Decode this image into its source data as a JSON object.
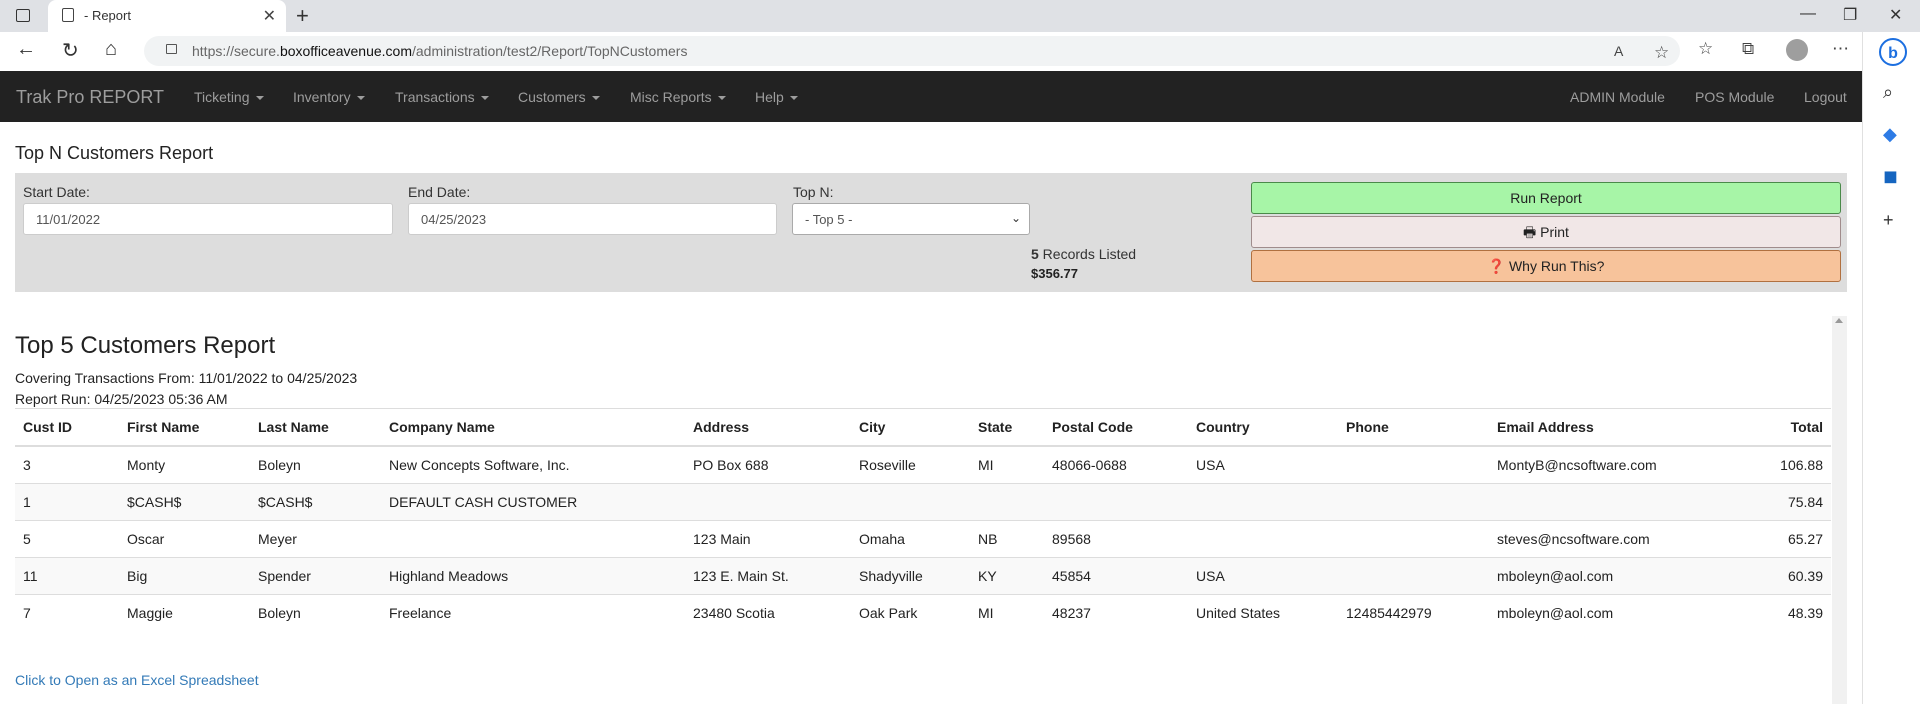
{
  "browser": {
    "tab_title": "- Report",
    "url_prefix": "https://secure.",
    "url_domain": "boxofficeavenue.com",
    "url_path": "/administration/test2/Report/TopNCustomers"
  },
  "navbar": {
    "brand": "Trak Pro REPORT",
    "menus": [
      "Ticketing",
      "Inventory",
      "Transactions",
      "Customers",
      "Misc Reports",
      "Help"
    ],
    "right_links": [
      "ADMIN Module",
      "POS Module",
      "Logout"
    ]
  },
  "page_title": "Top N Customers Report",
  "filters": {
    "start_label": "Start Date:",
    "start_value": "11/01/2022",
    "end_label": "End Date:",
    "end_value": "04/25/2023",
    "topn_label": "Top N:",
    "topn_value": "- Top 5 -",
    "records_count": "5",
    "records_suffix": " Records Listed",
    "total_amount": "$356.77"
  },
  "buttons": {
    "run": "Run Report",
    "print": "Print",
    "why": "Why Run This?"
  },
  "report": {
    "heading": "Top 5 Customers Report",
    "covering": "Covering Transactions From: 11/01/2022 to 04/25/2023",
    "run_at": "Report Run: 04/25/2023 05:36 AM",
    "columns": [
      "Cust ID",
      "First Name",
      "Last Name",
      "Company Name",
      "Address",
      "City",
      "State",
      "Postal Code",
      "Country",
      "Phone",
      "Email Address",
      "Total"
    ],
    "rows": [
      [
        "3",
        "Monty",
        "Boleyn",
        "New Concepts Software, Inc.",
        "PO Box 688",
        "Roseville",
        "MI",
        "48066-0688",
        "USA",
        "",
        "MontyB@ncsoftware.com",
        "106.88"
      ],
      [
        "1",
        "$CASH$",
        "$CASH$",
        "DEFAULT CASH CUSTOMER",
        "",
        "",
        "",
        "",
        "",
        "",
        "",
        "75.84"
      ],
      [
        "5",
        "Oscar",
        "Meyer",
        "",
        "123 Main",
        "Omaha",
        "NB",
        "89568",
        "",
        "",
        "steves@ncsoftware.com",
        "65.27"
      ],
      [
        "11",
        "Big",
        "Spender",
        "Highland Meadows",
        "123 E. Main St.",
        "Shadyville",
        "KY",
        "45854",
        "USA",
        "",
        "mboleyn@aol.com",
        "60.39"
      ],
      [
        "7",
        "Maggie",
        "Boleyn",
        "Freelance",
        "23480 Scotia",
        "Oak Park",
        "MI",
        "48237",
        "United States",
        "12485442979",
        "mboleyn@aol.com",
        "48.39"
      ]
    ],
    "excel_link": "Click to Open as an Excel Spreadsheet"
  }
}
